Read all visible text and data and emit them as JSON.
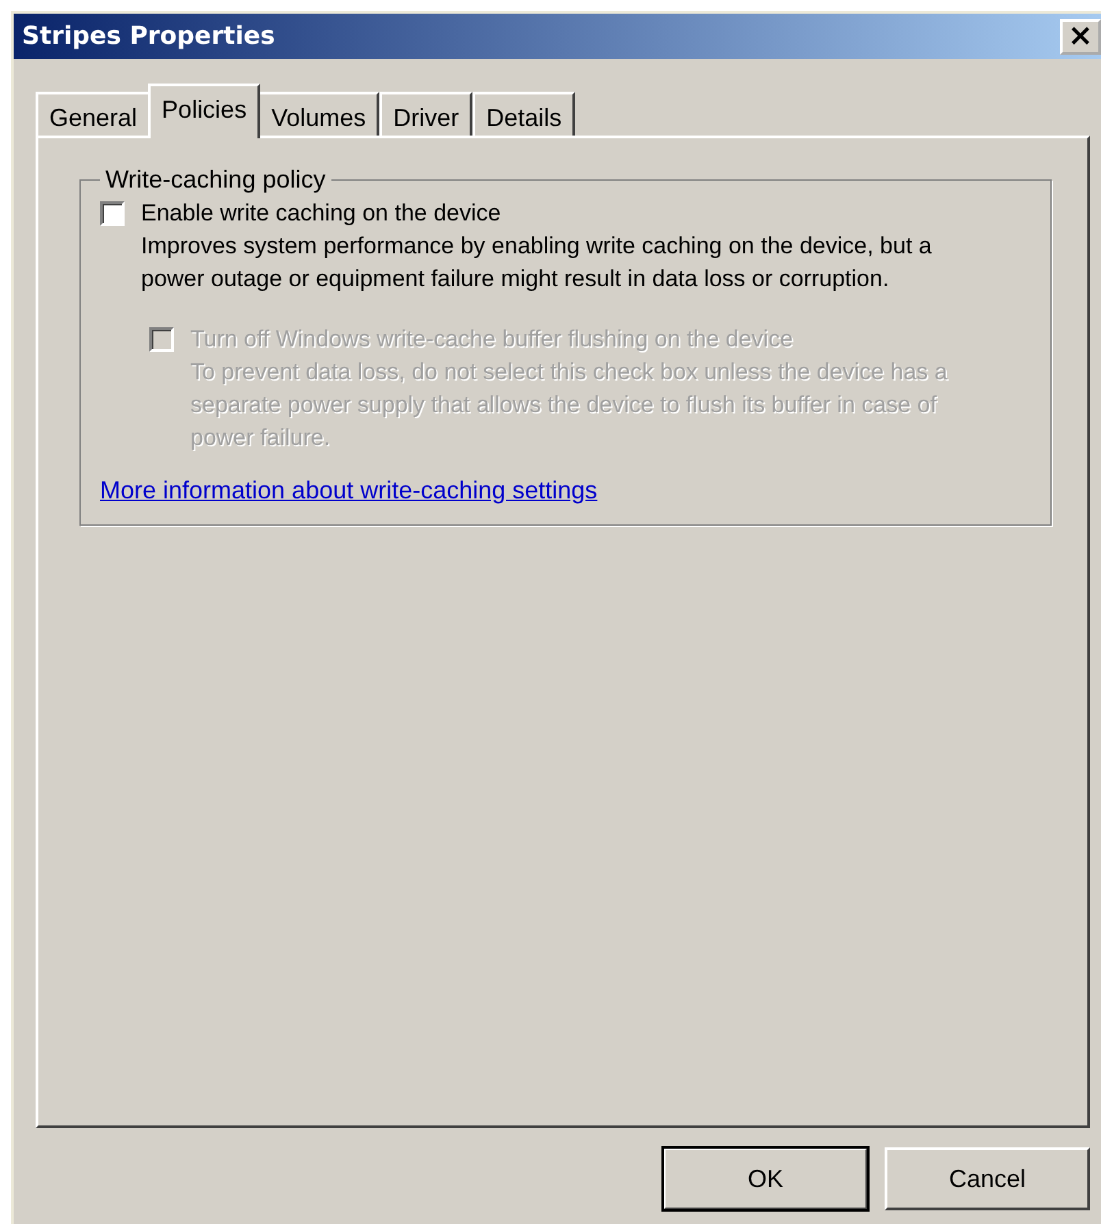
{
  "window": {
    "title": "Stripes Properties",
    "close": "×"
  },
  "tabs": [
    {
      "label": "General",
      "selected": false
    },
    {
      "label": "Policies",
      "selected": true
    },
    {
      "label": "Volumes",
      "selected": false
    },
    {
      "label": "Driver",
      "selected": false
    },
    {
      "label": "Details",
      "selected": false
    }
  ],
  "group": {
    "title": "Write-caching policy",
    "options": [
      {
        "label": "Enable write caching on the device",
        "checked": false,
        "disabled": false,
        "description": "Improves system performance by enabling write caching on the device, but a power outage or equipment failure might result in data loss or corruption.",
        "children": [
          {
            "label": "Turn off Windows write-cache buffer flushing on the device",
            "checked": false,
            "disabled": true,
            "description": "To prevent data loss, do not select this check box unless the device has a separate power supply that allows the device to flush its buffer in case of power failure."
          }
        ]
      }
    ],
    "link": "More information about write-caching settings"
  },
  "buttons": [
    {
      "label": "OK",
      "default": true
    },
    {
      "label": "Cancel",
      "default": false
    }
  ]
}
